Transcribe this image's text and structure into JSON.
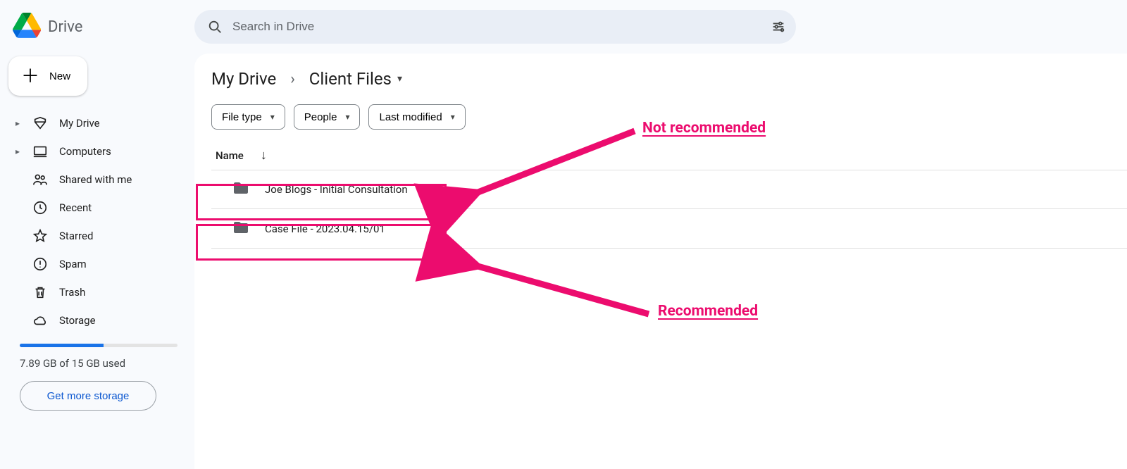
{
  "brand": {
    "name": "Drive"
  },
  "new_button": {
    "label": "New"
  },
  "sidebar": {
    "items": [
      {
        "label": "My Drive",
        "icon": "mydrive",
        "expandable": true
      },
      {
        "label": "Computers",
        "icon": "computer",
        "expandable": true
      },
      {
        "label": "Shared with me",
        "icon": "shared",
        "expandable": false
      },
      {
        "label": "Recent",
        "icon": "recent",
        "expandable": false
      },
      {
        "label": "Starred",
        "icon": "star",
        "expandable": false
      },
      {
        "label": "Spam",
        "icon": "spam",
        "expandable": false
      },
      {
        "label": "Trash",
        "icon": "trash",
        "expandable": false
      },
      {
        "label": "Storage",
        "icon": "cloud",
        "expandable": false
      }
    ]
  },
  "storage": {
    "used_label": "7.89 GB of 15 GB used",
    "get_more": "Get more storage",
    "used_pct": 53
  },
  "search": {
    "placeholder": "Search in Drive"
  },
  "breadcrumb": {
    "root": "My Drive",
    "current": "Client Files"
  },
  "chips": [
    {
      "label": "File type"
    },
    {
      "label": "People"
    },
    {
      "label": "Last modified"
    }
  ],
  "columns": {
    "name": "Name"
  },
  "rows": [
    {
      "name": "Joe Blogs - Initial Consultation"
    },
    {
      "name": "Case File - 2023.04.15/01"
    }
  ],
  "annotations": {
    "not_recommended": "Not recommended",
    "recommended": "Recommended"
  }
}
